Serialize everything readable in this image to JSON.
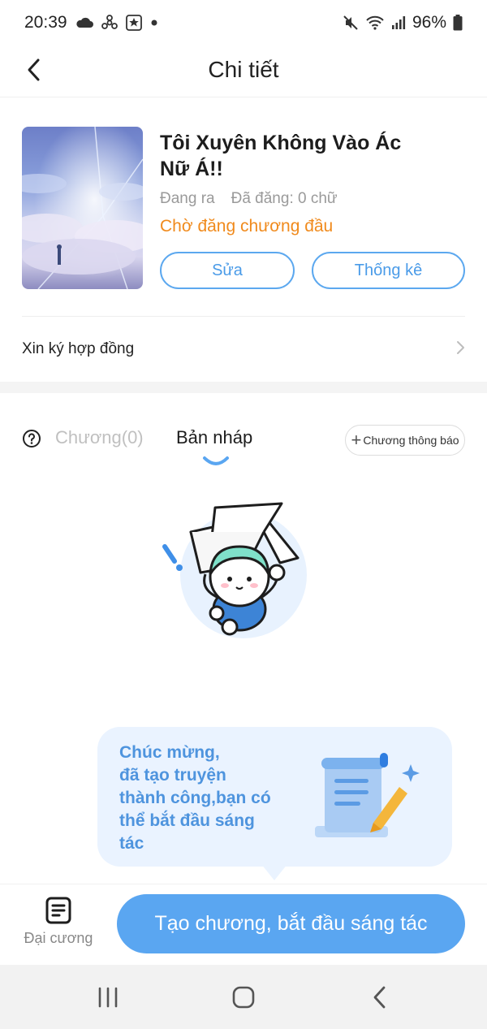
{
  "status_bar": {
    "time": "20:39",
    "battery": "96%"
  },
  "header": {
    "title": "Chi tiết"
  },
  "book": {
    "title": "Tôi Xuyên Không Vào Ác Nữ Á!!",
    "status": "Đang ra",
    "word_count": "Đã đăng: 0 chữ",
    "pending_notice": "Chờ đăng chương đầu",
    "edit_label": "Sửa",
    "stats_label": "Thống kê"
  },
  "contract": {
    "label": "Xin ký hợp đồng"
  },
  "tabs": {
    "chapters": "Chương(0)",
    "drafts": "Bản nháp",
    "active": "drafts"
  },
  "notice_button": {
    "label": "Chương thông báo"
  },
  "tooltip": {
    "text": "Chúc mừng,\nđã tạo truyện\nthành công,bạn có\nthể bắt đầu sáng\ntác"
  },
  "bottom": {
    "outline_label": "Đại cương",
    "cta_label": "Tạo chương, bắt đầu sáng tác"
  },
  "colors": {
    "accent": "#5aa6f1",
    "pending": "#f08a1c",
    "bubble_bg": "#eaf3ff",
    "bubble_text": "#4e94de"
  },
  "icons": {
    "status_left": [
      "cloud-icon",
      "fan-icon",
      "app-badge-icon",
      "dot-icon"
    ],
    "status_right": [
      "mute-icon",
      "wifi-icon",
      "signal-icon",
      "battery-icon"
    ]
  }
}
